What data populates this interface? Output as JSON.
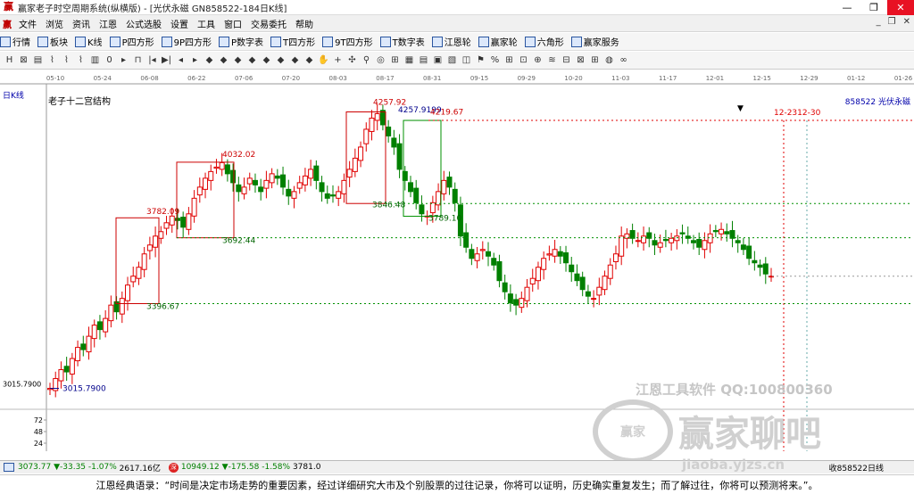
{
  "window": {
    "title": "赢家老子时空周期系统(纵横版) - [光伏永磁  GN858522-184日K线]",
    "controls": [
      "—",
      "❐",
      "✕"
    ]
  },
  "menu": {
    "items": [
      "文件",
      "浏览",
      "资讯",
      "江恩",
      "公式选股",
      "设置",
      "工具",
      "窗口",
      "交易委托",
      "帮助"
    ],
    "right": [
      "_",
      "❐",
      "✕"
    ]
  },
  "toolbar1": {
    "items": [
      {
        "label": "行情",
        "icon": "grid-icon"
      },
      {
        "label": "板块",
        "icon": "blocks-icon"
      },
      {
        "label": "K线",
        "icon": "candle-icon"
      },
      {
        "label": "P四方形",
        "icon": "p-square-icon"
      },
      {
        "label": "9P四方形",
        "icon": "9p-square-icon"
      },
      {
        "label": "P数字表",
        "icon": "p-table-icon"
      },
      {
        "label": "T四方形",
        "icon": "t-square-icon"
      },
      {
        "label": "9T四方形",
        "icon": "9t-square-icon"
      },
      {
        "label": "T数字表",
        "icon": "t-table-icon"
      },
      {
        "label": "江恩轮",
        "icon": "wheel-icon"
      },
      {
        "label": "赢家轮",
        "icon": "wheel2-icon"
      },
      {
        "label": "六角形",
        "icon": "hexagon-icon"
      },
      {
        "label": "赢家服务",
        "icon": "service-icon"
      }
    ]
  },
  "toolbar2": {
    "icons": [
      "H",
      "⊠",
      "▤",
      "⌇",
      "⌇",
      "⌇",
      "▥",
      "0",
      "▸",
      "⊓",
      "|◂",
      "▶|",
      "◂",
      "▸",
      "◆",
      "◆",
      "◆",
      "◆",
      "◆",
      "◆",
      "◆",
      "◆",
      "✋",
      "+",
      "✣",
      "⚲",
      "◎",
      "⊞",
      "▦",
      "▤",
      "▣",
      "▧",
      "◫",
      "⚑",
      "%",
      "⊞",
      "⊡",
      "⊕",
      "≋",
      "⊟",
      "⊠",
      "⊞",
      "◍",
      "∞"
    ]
  },
  "chart": {
    "panel_label": "日K线",
    "subtitle": "老子十二宫结构",
    "symbol": "858522  光伏永磁",
    "date_ticks": [
      "05-10",
      "05-24",
      "06-08",
      "06-22",
      "07-06",
      "07-20",
      "08-03",
      "08-17",
      "08-31",
      "09-15",
      "09-29",
      "10-20",
      "11-03",
      "11-17",
      "12-01",
      "12-15",
      "12-29",
      "01-12",
      "01-26"
    ],
    "price_annotations": [
      "4257.92",
      "4257.9199",
      "4219.67",
      "4032.02",
      "3782.09",
      "3846.48",
      "3789.10",
      "3692.44",
      "3396.67",
      "3015.7900"
    ],
    "marker_label": "12-2312-30",
    "left_axis_price": "3015.7900",
    "volume_ticks": [
      "72",
      "48",
      "24"
    ],
    "arrow": "▼"
  },
  "chart_data": {
    "type": "candlestick",
    "x_range_dates": [
      "05-10",
      "01-26"
    ],
    "ylim": [
      2950,
      4320
    ],
    "key_levels": [
      4257.92,
      4219.67,
      4032.02,
      3846.48,
      3789.1,
      3782.09,
      3692.44,
      3396.67,
      3015.79
    ],
    "series": [
      {
        "close": [
          3016,
          3060,
          3100,
          3090,
          3150,
          3200,
          3190,
          3250,
          3300,
          3280,
          3330,
          3390,
          3360,
          3420,
          3480,
          3520,
          3560,
          3620,
          3660,
          3700,
          3720,
          3760,
          3790,
          3770,
          3740,
          3800,
          3870,
          3920,
          3960,
          3990,
          4010,
          4030,
          3980,
          3940,
          3900,
          3920,
          3960,
          3930,
          3900,
          3950,
          3980,
          3960,
          3920,
          3880,
          3900,
          3940,
          3970,
          4000,
          3950,
          3900,
          3870,
          3880,
          3900,
          3950,
          4000,
          4050,
          4100,
          4180,
          4230,
          4250,
          4200,
          4150,
          4100,
          4000,
          3950,
          3900,
          3850,
          3800,
          3790,
          3850,
          3900,
          3950,
          3920,
          3850,
          3700,
          3650,
          3600,
          3620,
          3640,
          3610,
          3570,
          3500,
          3450,
          3400,
          3390,
          3420,
          3470,
          3510,
          3560,
          3600,
          3620,
          3640,
          3610,
          3580,
          3540,
          3500,
          3460,
          3430,
          3420,
          3470,
          3520,
          3570,
          3620,
          3700,
          3710,
          3690,
          3680,
          3700,
          3690,
          3660,
          3670,
          3680,
          3690,
          3700,
          3710,
          3690,
          3670,
          3650,
          3680,
          3710,
          3720,
          3730,
          3710,
          3690,
          3670,
          3640,
          3600,
          3580,
          3560,
          3530,
          3520
        ]
      }
    ]
  },
  "status": {
    "index1": "3073.77",
    "index1_change": "▼-33.35",
    "index1_pct": "-1.07%",
    "index1_vol": "2617.16亿",
    "index2": "10949.12",
    "index2_change": "▼-175.58",
    "index2_pct": "-1.58%",
    "index2_vol": "3781.0",
    "right": "收858522日线"
  },
  "footer": {
    "quote": "江恩经典语录：“时间是决定市场走势的重要因素，经过详细研究大市及个别股票的过往记录，你将可以证明，历史确实重复发生；而了解过往，你将可以预测将来。”。"
  },
  "watermark": {
    "line1": "江恩工具软件  QQ:100800360",
    "line2": "赢家聊吧",
    "line3": "jiaoba.yjzs.cn",
    "seal": "赢家"
  },
  "colors": {
    "up": "#e00000",
    "down": "#008000",
    "annotation_red": "#cc0000",
    "annotation_green": "#006400",
    "guide_green": "#009000",
    "marker_red": "#e00000"
  }
}
